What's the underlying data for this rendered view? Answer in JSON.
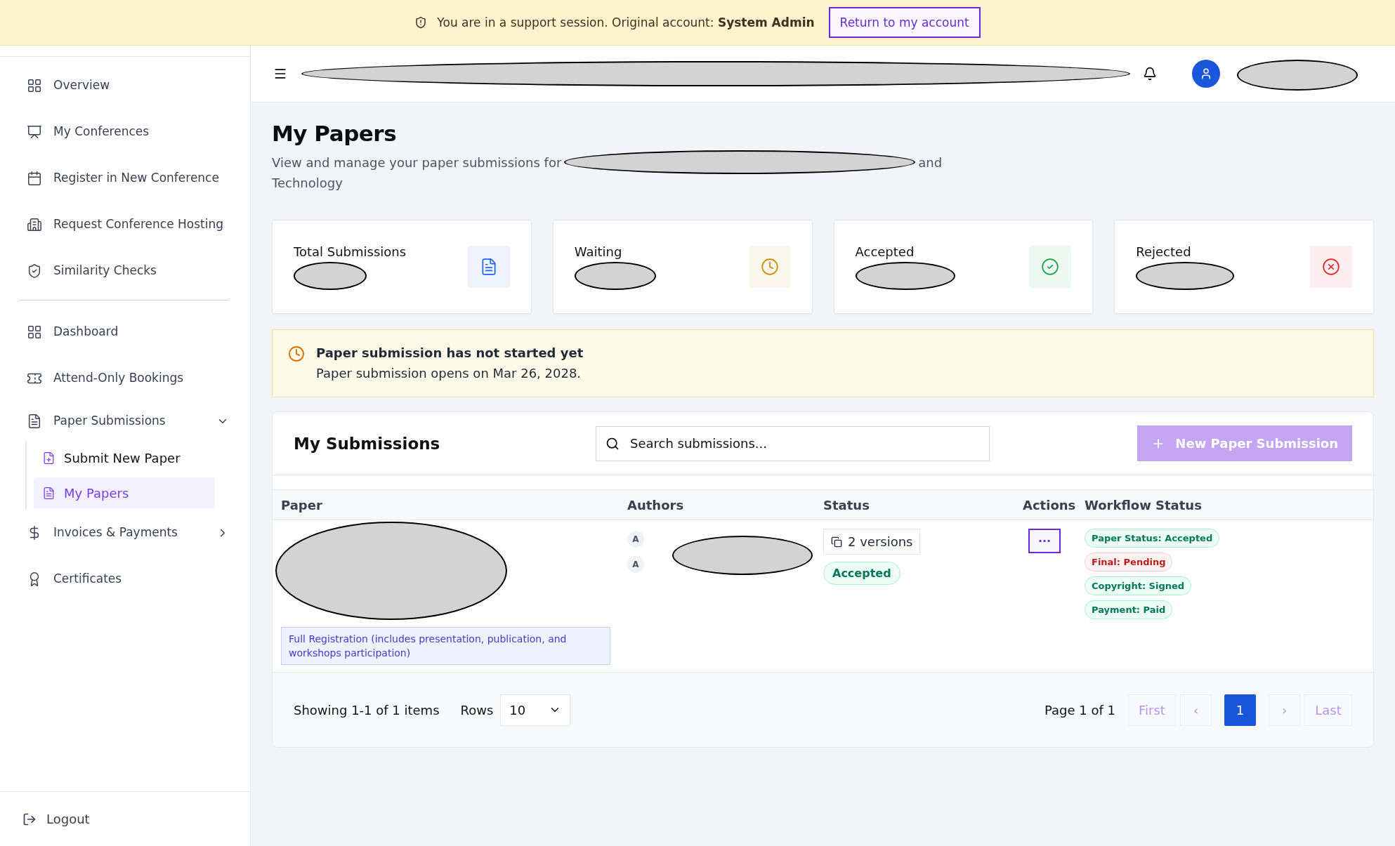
{
  "support_banner": {
    "text": "You are in a support session. Original account: **System Admin**",
    "button": "Return to my account"
  },
  "sidebar": {
    "groups": [
      [
        {
          "label": "Overview",
          "selected": false
        },
        {
          "label": "My Conferences",
          "selected": false
        },
        {
          "label": "Register in New Conference",
          "selected": false
        },
        {
          "label": "Request Conference Hosting",
          "selected": false
        },
        {
          "label": "Similarity Checks",
          "selected": false
        }
      ],
      [
        {
          "label": "Dashboard",
          "selected": false
        },
        {
          "label": "Attend-Only Bookings",
          "selected": false
        },
        {
          "label": "Paper Submissions",
          "selected": false,
          "expanded": true,
          "children": [
            {
              "label": "Submit New Paper",
              "selected": false
            },
            {
              "label": "My Papers",
              "selected": true
            }
          ]
        },
        {
          "label": "Invoices & Payments",
          "selected": false,
          "expanded": false
        },
        {
          "label": "Certificates",
          "selected": false
        }
      ]
    ],
    "logout": "Logout"
  },
  "page": {
    "title": "My Papers",
    "description_start": "View and manage your paper submissions for",
    "description_after_redaction": "and",
    "description_second_line": "Technology"
  },
  "stats": [
    {
      "label": "Total Submissions",
      "color": "#2563eb"
    },
    {
      "label": "Waiting",
      "color": "#ca8a04"
    },
    {
      "label": "Accepted",
      "color": "#16a34a"
    },
    {
      "label": "Rejected",
      "color": "#dc2626"
    }
  ],
  "alert": {
    "title": "Paper submission has not started yet",
    "text": "Paper submission opens on Mar 26, 2028."
  },
  "submissions": {
    "title": "My Submissions",
    "search": {
      "placeholder": "Search submissions..."
    },
    "new_button": "New Paper Submission",
    "new_button_disabled": true,
    "columns": [
      "Paper",
      "Authors",
      "Status",
      "Actions",
      "Workflow Status"
    ],
    "rows": [
      {
        "registration": "Full Registration (includes presentation, publication, and workshops participation)",
        "author_initials": [
          "A",
          "A"
        ],
        "versions": "2 versions",
        "status": "Accepted",
        "actions": "···",
        "workflow": [
          {
            "label": "Paper Status: Accepted",
            "kind": "ok"
          },
          {
            "label": "Final: Pending",
            "kind": "pending"
          },
          {
            "label": "Copyright: Signed",
            "kind": "ok"
          },
          {
            "label": "Payment: Paid",
            "kind": "ok"
          }
        ]
      }
    ],
    "footer": {
      "showing": "Showing 1-1 of 1 items",
      "rows_label": "Rows",
      "rows_value": "10",
      "page_text": "Page 1 of 1",
      "first": "First",
      "last": "Last",
      "prev": "‹",
      "next": "›",
      "pages": [
        {
          "label": "1",
          "selected": true
        }
      ]
    }
  }
}
